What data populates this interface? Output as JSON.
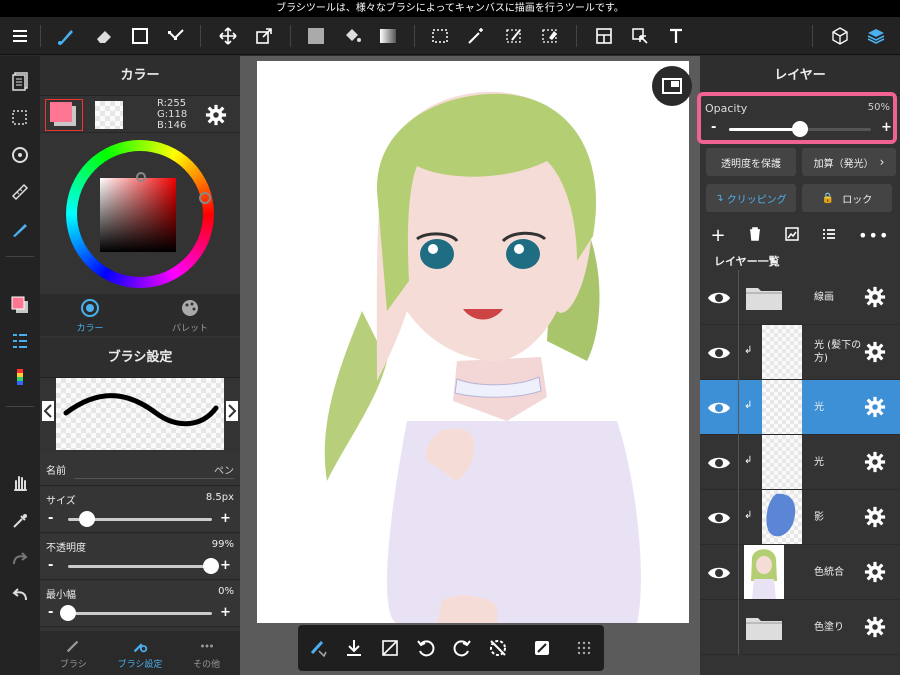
{
  "tooltip": "ブラシツールは、様々なブラシによってキャンバスに描画を行うツールです。",
  "colors": {
    "current": "#FF7692",
    "highlight": "#F06292",
    "selected_layer": "#3d8fd6"
  },
  "color_panel": {
    "title": "カラー",
    "rgb": {
      "r": "R:255",
      "g": "G:118",
      "b": "B:146"
    },
    "tab_color": "カラー",
    "tab_palette": "パレット"
  },
  "brush_panel": {
    "title": "ブラシ設定",
    "name_label": "名前",
    "name_value": "ペン",
    "size_label": "サイズ",
    "size_value": "8.5px",
    "size_level": 0.13,
    "opacity_label": "不透明度",
    "opacity_value": "99%",
    "opacity_level": 0.99,
    "minwidth_label": "最小幅",
    "minwidth_value": "0%",
    "minwidth_level": 0.0,
    "tab_brush": "ブラシ",
    "tab_brush_settings": "ブラシ設定",
    "tab_other": "その他"
  },
  "layer_panel": {
    "title": "レイヤー",
    "opacity_label": "Opacity",
    "opacity_value": "50%",
    "opacity_level": 0.5,
    "protect_alpha": "透明度を保護",
    "blend_mode": "加算（発光）",
    "clipping": "クリッピング",
    "lock": "ロック",
    "list_title": "レイヤー一覧",
    "layers": [
      {
        "name": "線画"
      },
      {
        "name": "光 (髪下の方)"
      },
      {
        "name": "光"
      },
      {
        "name": "光"
      },
      {
        "name": "影"
      },
      {
        "name": "色統合"
      },
      {
        "name": "色塗り"
      }
    ]
  }
}
